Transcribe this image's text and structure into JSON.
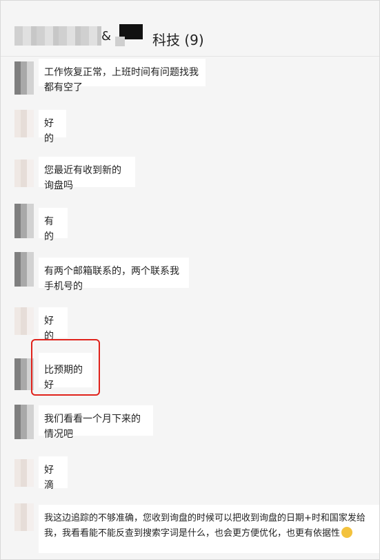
{
  "header": {
    "title_visible": "&",
    "title_suffix": "科技 (9)"
  },
  "messages": [
    {
      "text": "工作恢复正常，上班时间有问题找我都有空了"
    },
    {
      "text": "好的"
    },
    {
      "text": "您最近有收到新的询盘吗"
    },
    {
      "text": "有的"
    },
    {
      "text": "有两个邮箱联系的，两个联系我手机号的"
    },
    {
      "text": "好的"
    },
    {
      "text": "比预期的好"
    },
    {
      "text": "我们看看一个月下来的情况吧"
    },
    {
      "text": "好滴"
    },
    {
      "text": "我这边追踪的不够准确，您收到询盘的时候可以把收到询盘的日期+时和国家发给我，我看看能不能反查到搜索字词是什么，也会更方便优化，也更有依据性"
    }
  ],
  "colors": {
    "highlight": "#e0221b",
    "bubble": "#ffffff",
    "background": "#f5f5f5"
  }
}
